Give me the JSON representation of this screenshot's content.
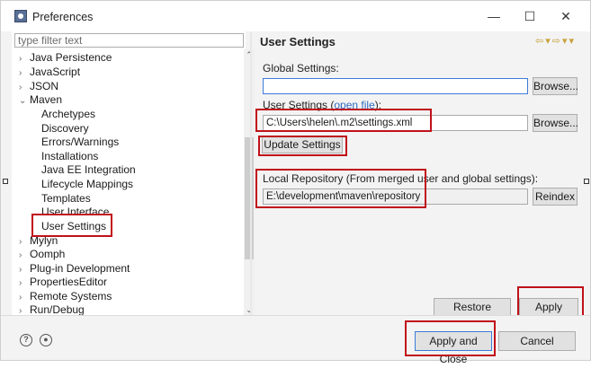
{
  "window": {
    "title": "Preferences"
  },
  "titlebar": {
    "minimize": "—",
    "maximize": "☐",
    "close": "✕"
  },
  "left": {
    "filter_placeholder": "type filter text",
    "tree": [
      {
        "label": "Java Persistence",
        "expanded": false
      },
      {
        "label": "JavaScript",
        "expanded": false
      },
      {
        "label": "JSON",
        "expanded": false
      },
      {
        "label": "Maven",
        "expanded": true
      },
      {
        "label": "Archetypes"
      },
      {
        "label": "Discovery"
      },
      {
        "label": "Errors/Warnings"
      },
      {
        "label": "Installations"
      },
      {
        "label": "Java EE Integration"
      },
      {
        "label": "Lifecycle Mappings"
      },
      {
        "label": "Templates"
      },
      {
        "label": "User Interface"
      },
      {
        "label": "User Settings",
        "selected": true
      },
      {
        "label": "Mylyn",
        "expanded": false
      },
      {
        "label": "Oomph",
        "expanded": false
      },
      {
        "label": "Plug-in Development",
        "expanded": false
      },
      {
        "label": "PropertiesEditor",
        "expanded": false
      },
      {
        "label": "Remote Systems",
        "expanded": false
      },
      {
        "label": "Run/Debug",
        "expanded": false
      }
    ]
  },
  "right": {
    "title": "User Settings",
    "global_label": "Global Settings:",
    "global_value": "",
    "browse_label": "Browse...",
    "user_label": "User Settings",
    "open_file": "open file",
    "user_value": "C:\\Users\\helen\\.m2\\settings.xml",
    "update_label": "Update Settings",
    "local_label": "Local Repository (From merged user and global settings):",
    "local_value": "E:\\development\\maven\\repository",
    "reindex_label": "Reindex",
    "restore_label": "Restore Defaults",
    "apply_label": "Apply"
  },
  "footer": {
    "apply_close_label": "Apply and Close",
    "cancel_label": "Cancel"
  },
  "colors": {
    "highlight": "#c0101a",
    "link": "#2f6bbf"
  }
}
